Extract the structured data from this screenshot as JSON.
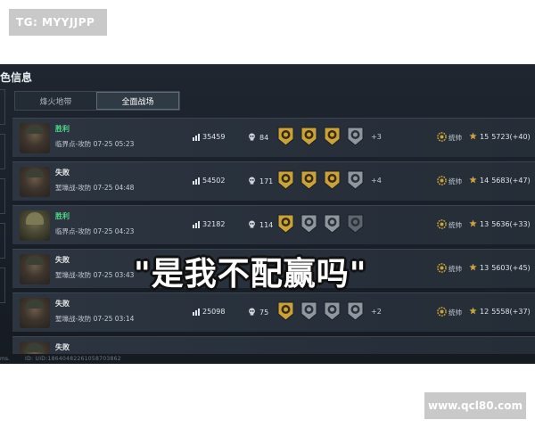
{
  "watermarks": {
    "top": "TG: MYYJJPP",
    "bottom": "www.qcl80.com"
  },
  "panel": {
    "title": "色信息"
  },
  "tabs": [
    {
      "label": "烽火地带",
      "active": false
    },
    {
      "label": "全面战场",
      "active": true
    }
  ],
  "matches": [
    {
      "result": "胜利",
      "result_type": "win",
      "mode": "临界点-攻防 07-25 05:23",
      "score": "35459",
      "kills": "84",
      "badges": [
        "gold",
        "gold",
        "gold",
        "silver"
      ],
      "extra": "+3",
      "rank_label": "统帅",
      "level": "15",
      "points": "5723(+40)",
      "avatar": "brown"
    },
    {
      "result": "失败",
      "result_type": "lose",
      "mode": "堑壕战-攻防 07-25 04:48",
      "score": "54502",
      "kills": "171",
      "badges": [
        "gold",
        "gold",
        "gold",
        "silver"
      ],
      "extra": "+4",
      "rank_label": "统帅",
      "level": "14",
      "points": "5683(+47)",
      "avatar": "brown"
    },
    {
      "result": "胜利",
      "result_type": "win",
      "mode": "临界点-攻防 07-25 04:23",
      "score": "32182",
      "kills": "114",
      "badges": [
        "gold",
        "silver",
        "silver",
        "dark"
      ],
      "extra": "",
      "rank_label": "统帅",
      "level": "13",
      "points": "5636(+33)",
      "avatar": "green"
    },
    {
      "result": "失败",
      "result_type": "lose",
      "mode": "堑壕战-攻防 07-25 03:43",
      "score": "",
      "kills": "",
      "badges": [],
      "extra": "",
      "rank_label": "统帅",
      "level": "13",
      "points": "5603(+45)",
      "avatar": "brown"
    },
    {
      "result": "失败",
      "result_type": "lose",
      "mode": "堑壕战-攻防 07-25 03:14",
      "score": "25098",
      "kills": "75",
      "badges": [
        "gold",
        "silver",
        "silver",
        "silver"
      ],
      "extra": "+2",
      "rank_label": "统帅",
      "level": "12",
      "points": "5558(+37)",
      "avatar": "brown"
    },
    {
      "result": "失败",
      "result_type": "lose",
      "mode": "",
      "score": "",
      "kills": "",
      "badges": [],
      "extra": "",
      "rank_label": "",
      "level": "",
      "points": "",
      "avatar": "brown",
      "clipped": true
    }
  ],
  "caption": "\"是我不配赢吗\"",
  "footer": {
    "left": "ms.",
    "id": "ID: UID:18640482261058703862"
  },
  "colors": {
    "win": "#4fd88a",
    "lose": "#e6e6e6",
    "gold": "#c9a23a",
    "silver": "#8e979f",
    "background": "#1c232c"
  },
  "icons": {
    "score": "bar-chart-icon",
    "kills": "skull-icon",
    "rank": "gear-emblem-icon",
    "level": "star-icon"
  }
}
